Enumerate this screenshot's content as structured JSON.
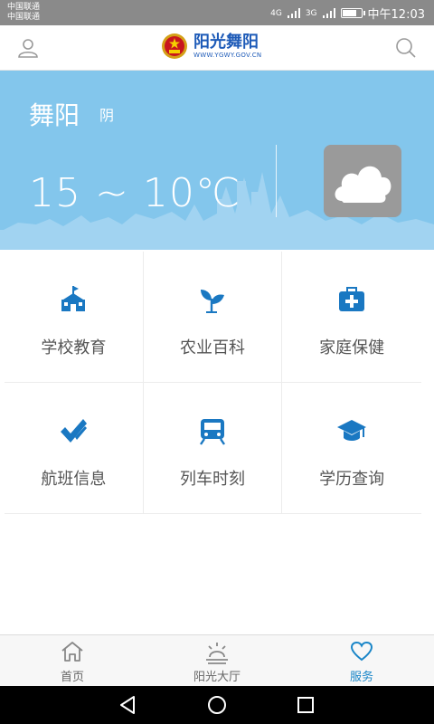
{
  "status_bar": {
    "carrier_1": "中国联通",
    "carrier_2": "中国联通",
    "signal_1": "4G",
    "signal_2": "3G",
    "time": "中午12:03"
  },
  "header": {
    "title": "阳光舞阳",
    "url": "WWW.YGWY.GOV.CN"
  },
  "weather": {
    "city": "舞阳",
    "condition": "阴",
    "temperature": "15 ~ 10℃"
  },
  "services": [
    {
      "label": "学校教育",
      "icon": "school-icon"
    },
    {
      "label": "农业百科",
      "icon": "sprout-icon"
    },
    {
      "label": "家庭保健",
      "icon": "medical-kit-icon"
    },
    {
      "label": "航班信息",
      "icon": "check-icon"
    },
    {
      "label": "列车时刻",
      "icon": "train-icon"
    },
    {
      "label": "学历查询",
      "icon": "graduation-cap-icon"
    }
  ],
  "tabs": [
    {
      "label": "首页",
      "icon": "home-icon"
    },
    {
      "label": "阳光大厅",
      "icon": "sunrise-icon"
    },
    {
      "label": "服务",
      "icon": "heart-icon",
      "active": true
    }
  ],
  "colors": {
    "accent": "#1a86c8",
    "icon_blue": "#1a78c2",
    "weather_bg": "#83c6ec"
  }
}
